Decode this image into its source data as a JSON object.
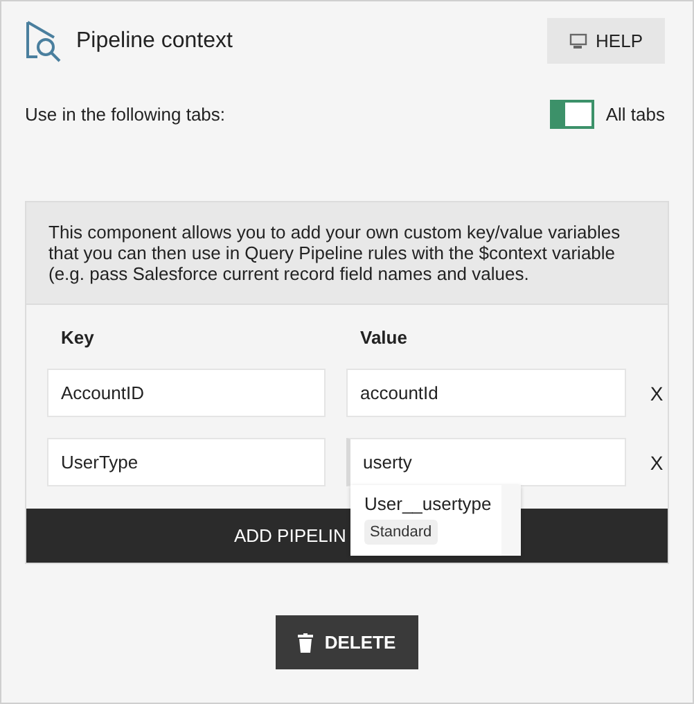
{
  "header": {
    "title": "Pipeline context",
    "help_button": "HELP"
  },
  "tabs_setting": {
    "label": "Use in the following tabs:",
    "toggle": {
      "on": true,
      "label": "All tabs"
    }
  },
  "info": "This component allows you to add your own custom key/value variables that you can then use in Query Pipeline rules with the $context variable (e.g. pass Salesforce current record field names and values.",
  "columns": [
    "Key",
    "Value"
  ],
  "rows": [
    {
      "key": "AccountID",
      "value": "accountId",
      "focused": false,
      "remove": "X"
    },
    {
      "key": "UserType",
      "value": "userty",
      "focused": true,
      "remove": "X"
    }
  ],
  "suggestion": {
    "name": "User__usertype",
    "tag": "Standard"
  },
  "add_button": "ADD PIPELIN",
  "delete_button": "DELETE"
}
